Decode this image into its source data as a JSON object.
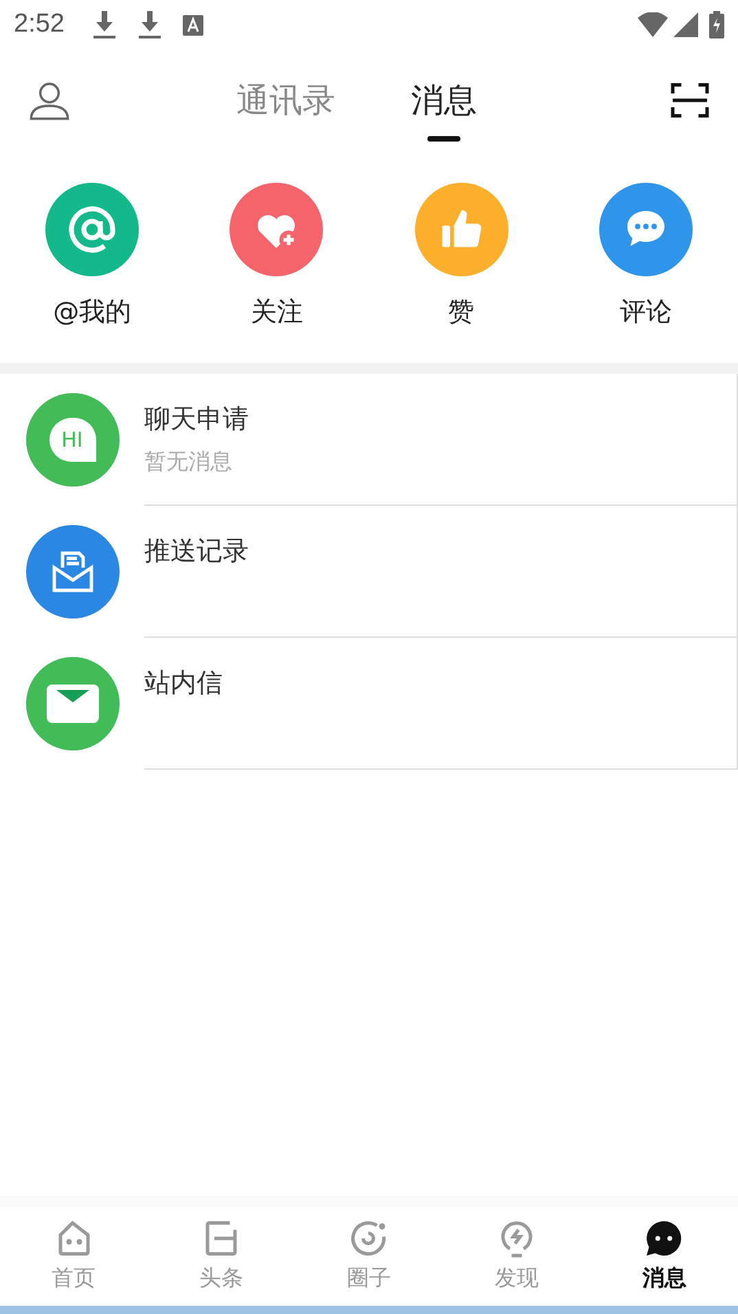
{
  "status_bar": {
    "time": "2:52"
  },
  "header": {
    "tabs": [
      {
        "label": "通讯录",
        "selected": false
      },
      {
        "label": "消息",
        "selected": true
      }
    ]
  },
  "quick_actions": [
    {
      "label": "@我的",
      "kind": "at",
      "color": "#13b98b"
    },
    {
      "label": "关注",
      "kind": "heart",
      "color": "#f5636b"
    },
    {
      "label": "赞",
      "kind": "like",
      "color": "#fbaf2a"
    },
    {
      "label": "评论",
      "kind": "comment",
      "color": "#2e95ea"
    }
  ],
  "messages": [
    {
      "title": "聊天申请",
      "subtitle": "暂无消息",
      "kind": "chat",
      "icon_text": "HI",
      "color": "#43bb57"
    },
    {
      "title": "推送记录",
      "kind": "push",
      "color": "#2a87e4"
    },
    {
      "title": "站内信",
      "kind": "mail",
      "color": "#41bc57"
    }
  ],
  "bottom_nav": [
    {
      "label": "首页",
      "kind": "home",
      "selected": false
    },
    {
      "label": "头条",
      "kind": "news",
      "selected": false
    },
    {
      "label": "圈子",
      "kind": "circle",
      "selected": false
    },
    {
      "label": "发现",
      "kind": "discover",
      "selected": false
    },
    {
      "label": "消息",
      "kind": "message",
      "selected": true
    }
  ]
}
